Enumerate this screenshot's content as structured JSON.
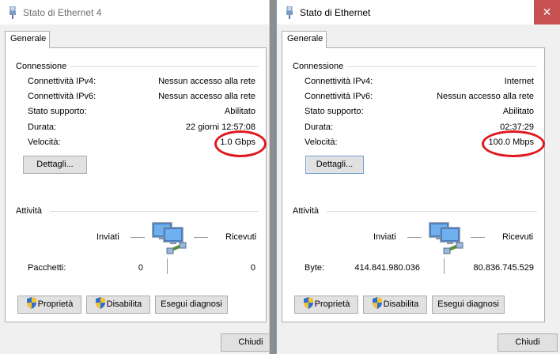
{
  "left": {
    "title": "Stato di Ethernet 4",
    "tab": "Generale",
    "connection_heading": "Connessione",
    "rows": [
      {
        "label": "Connettività IPv4:",
        "value": "Nessun accesso alla rete"
      },
      {
        "label": "Connettività IPv6:",
        "value": "Nessun accesso alla rete"
      },
      {
        "label": "Stato supporto:",
        "value": "Abilitato"
      },
      {
        "label": "Durata:",
        "value": "22 giorni 12:57:08"
      },
      {
        "label": "Velocità:",
        "value": "1.0 Gbps"
      }
    ],
    "details_button": "Dettagli...",
    "activity_heading": "Attività",
    "sent_label": "Inviati",
    "received_label": "Ricevuti",
    "counter_label": "Pacchetti:",
    "sent_value": "0",
    "received_value": "0",
    "properties_button": "Proprietà",
    "disable_button": "Disabilita",
    "diagnose_button": "Esegui diagnosi",
    "close_button": "Chiudi"
  },
  "right": {
    "title": "Stato di Ethernet",
    "tab": "Generale",
    "connection_heading": "Connessione",
    "rows": [
      {
        "label": "Connettività IPv4:",
        "value": "Internet"
      },
      {
        "label": "Connettività IPv6:",
        "value": "Nessun accesso alla rete"
      },
      {
        "label": "Stato supporto:",
        "value": "Abilitato"
      },
      {
        "label": "Durata:",
        "value": "02:37:29"
      },
      {
        "label": "Velocità:",
        "value": "100.0 Mbps"
      }
    ],
    "details_button": "Dettagli...",
    "activity_heading": "Attività",
    "sent_label": "Inviati",
    "received_label": "Ricevuti",
    "counter_label": "Byte:",
    "sent_value": "414.841.980.036",
    "received_value": "80.836.745.529",
    "properties_button": "Proprietà",
    "disable_button": "Disabilita",
    "diagnose_button": "Esegui diagnosi",
    "close_button": "Chiudi",
    "close_icon": "✕"
  },
  "colors": {
    "annotation_circle": "#e0181e",
    "close_button_bg": "#c75050",
    "shield_blue": "#2f6fd0",
    "shield_yellow": "#f4c430"
  },
  "icons": {
    "title": "ethernet-plug-icon",
    "network": "network-computers-icon",
    "shield": "uac-shield-icon"
  }
}
